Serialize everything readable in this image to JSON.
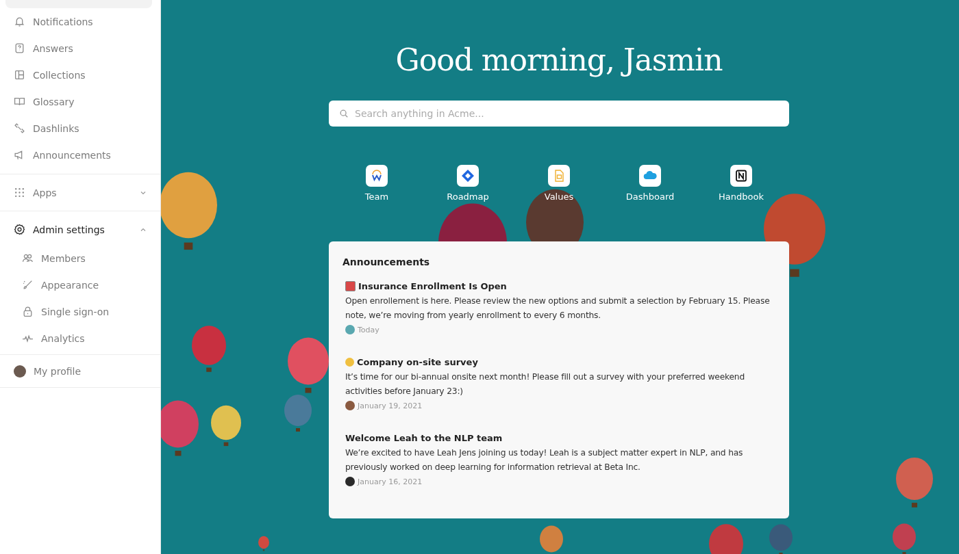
{
  "sidebar": {
    "nav_items": [
      {
        "label": "Notifications"
      },
      {
        "label": "Answers"
      },
      {
        "label": "Collections"
      },
      {
        "label": "Glossary"
      },
      {
        "label": "Dashlinks"
      },
      {
        "label": "Announcements"
      }
    ],
    "groups": [
      {
        "label": "Apps",
        "expanded": false
      },
      {
        "label": "Admin settings",
        "expanded": true,
        "children": [
          {
            "label": "Members"
          },
          {
            "label": "Appearance"
          },
          {
            "label": "Single sign-on"
          },
          {
            "label": "Analytics"
          }
        ]
      }
    ],
    "profile": {
      "label": "My profile"
    }
  },
  "greeting": "Good morning, Jasmin",
  "search": {
    "placeholder": "Search anything in Acme..."
  },
  "shortcuts": [
    {
      "label": "Team"
    },
    {
      "label": "Roadmap"
    },
    {
      "label": "Values"
    },
    {
      "label": "Dashboard"
    },
    {
      "label": "Handbook"
    }
  ],
  "announcements": {
    "title": "Announcements",
    "items": [
      {
        "title": "Insurance Enrollment Is Open",
        "body": "Open enrollement is here. Please review the new options and submit a selection by February 15. Please note, we’re moving from yearly enrollment to every 6 months.",
        "date": "Today"
      },
      {
        "title": "Company on-site survey",
        "body": "It’s time for our bi-annual onsite next month! Please fill out a survey with your preferred weekend activities before January 23:)",
        "date": "January 19, 2021"
      },
      {
        "title": "Welcome Leah to the NLP team",
        "body": "We’re excited to have Leah Jens joining us today! Leah is a subject matter expert in NLP, and has previously worked on deep learning for information retrieval at Beta Inc.",
        "date": "January 16, 2021"
      }
    ]
  }
}
